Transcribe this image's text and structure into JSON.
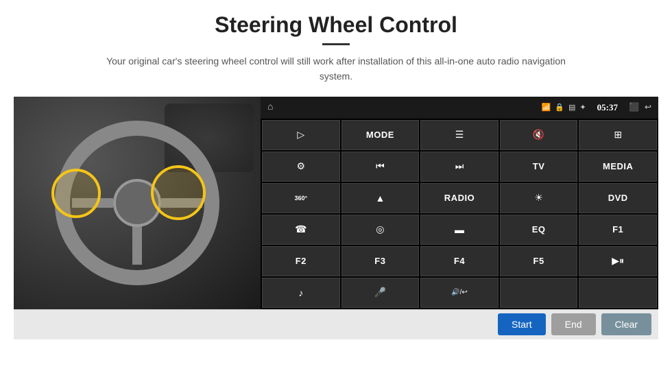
{
  "page": {
    "title": "Steering Wheel Control",
    "subtitle": "Your original car's steering wheel control will still work after installation of this all-in-one auto radio navigation system.",
    "divider": true
  },
  "status_bar": {
    "time": "05:37",
    "icons": [
      "wifi",
      "lock",
      "sd",
      "bluetooth",
      "cast",
      "back"
    ]
  },
  "grid_buttons": [
    {
      "id": "r1c1",
      "type": "icon",
      "icon": "▷",
      "label": "navigate-icon"
    },
    {
      "id": "r1c2",
      "type": "text",
      "text": "MODE",
      "label": "mode-button"
    },
    {
      "id": "r1c3",
      "type": "icon",
      "icon": "≡",
      "label": "list-icon"
    },
    {
      "id": "r1c4",
      "type": "icon",
      "icon": "🔇",
      "label": "mute-icon"
    },
    {
      "id": "r1c5",
      "type": "icon",
      "icon": "⊞",
      "label": "apps-icon"
    },
    {
      "id": "r2c1",
      "type": "icon",
      "icon": "⚙",
      "label": "settings-icon"
    },
    {
      "id": "r2c2",
      "type": "icon",
      "icon": "⏮",
      "label": "prev-icon"
    },
    {
      "id": "r2c3",
      "type": "icon",
      "icon": "⏭",
      "label": "next-icon"
    },
    {
      "id": "r2c4",
      "type": "text",
      "text": "TV",
      "label": "tv-button"
    },
    {
      "id": "r2c5",
      "type": "text",
      "text": "MEDIA",
      "label": "media-button"
    },
    {
      "id": "r3c1",
      "type": "icon",
      "icon": "360",
      "label": "camera-icon"
    },
    {
      "id": "r3c2",
      "type": "icon",
      "icon": "▲",
      "label": "eject-icon"
    },
    {
      "id": "r3c3",
      "type": "text",
      "text": "RADIO",
      "label": "radio-button"
    },
    {
      "id": "r3c4",
      "type": "icon",
      "icon": "☀",
      "label": "brightness-icon"
    },
    {
      "id": "r3c5",
      "type": "text",
      "text": "DVD",
      "label": "dvd-button"
    },
    {
      "id": "r4c1",
      "type": "icon",
      "icon": "☎",
      "label": "phone-icon"
    },
    {
      "id": "r4c2",
      "type": "icon",
      "icon": "◎",
      "label": "navi-icon"
    },
    {
      "id": "r4c3",
      "type": "icon",
      "icon": "▬",
      "label": "screen-icon"
    },
    {
      "id": "r4c4",
      "type": "text",
      "text": "EQ",
      "label": "eq-button"
    },
    {
      "id": "r4c5",
      "type": "text",
      "text": "F1",
      "label": "f1-button"
    },
    {
      "id": "r5c1",
      "type": "text",
      "text": "F2",
      "label": "f2-button"
    },
    {
      "id": "r5c2",
      "type": "text",
      "text": "F3",
      "label": "f3-button"
    },
    {
      "id": "r5c3",
      "type": "text",
      "text": "F4",
      "label": "f4-button"
    },
    {
      "id": "r5c4",
      "type": "text",
      "text": "F5",
      "label": "f5-button"
    },
    {
      "id": "r5c5",
      "type": "icon",
      "icon": "▶⏸",
      "label": "playpause-icon"
    },
    {
      "id": "r6c1",
      "type": "icon",
      "icon": "♪",
      "label": "music-icon"
    },
    {
      "id": "r6c2",
      "type": "icon",
      "icon": "🎤",
      "label": "mic-icon"
    },
    {
      "id": "r6c3",
      "type": "icon",
      "icon": "🔊/↩",
      "label": "speaker-icon"
    },
    {
      "id": "r6c4",
      "type": "empty",
      "text": "",
      "label": "empty-1"
    },
    {
      "id": "r6c5",
      "type": "empty",
      "text": "",
      "label": "empty-2"
    }
  ],
  "bottom_bar": {
    "start_label": "Start",
    "end_label": "End",
    "clear_label": "Clear"
  }
}
